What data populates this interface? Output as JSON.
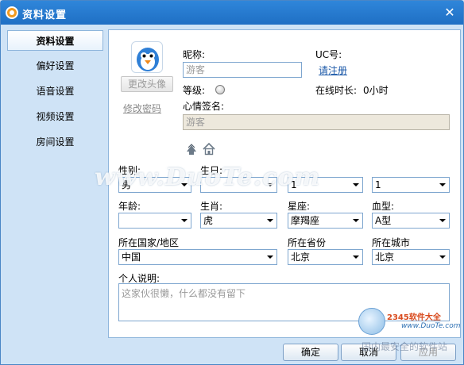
{
  "window": {
    "title": "资料设置",
    "close_glyph": "✕"
  },
  "sidebar": {
    "items": [
      {
        "label": "资料设置",
        "active": true
      },
      {
        "label": "偏好设置"
      },
      {
        "label": "语音设置"
      },
      {
        "label": "视频设置"
      },
      {
        "label": "房间设置"
      }
    ]
  },
  "profile": {
    "change_avatar_label": "更改头像",
    "change_password_label": "修改密码",
    "nickname_label": "昵称:",
    "nickname_value": "游客",
    "uc_label": "UC号:",
    "register_link": "请注册",
    "level_label": "等级:",
    "online_label": "在线时长:",
    "online_value": "0小时",
    "signature_label": "心情签名:",
    "signature_value": "游客",
    "icons": [
      "clover-icon",
      "home-icon"
    ]
  },
  "fields": {
    "gender": {
      "label": "性别:",
      "value": "男"
    },
    "birthday": {
      "label": "生日:",
      "year": "",
      "month": "1",
      "day": "1"
    },
    "age": {
      "label": "年龄:",
      "value": ""
    },
    "zodiac": {
      "label": "生肖:",
      "value": "虎"
    },
    "constellation": {
      "label": "星座:",
      "value": "摩羯座"
    },
    "blood": {
      "label": "血型:",
      "value": "A型"
    },
    "country": {
      "label": "所在国家/地区",
      "value": "中国"
    },
    "province": {
      "label": "所在省份",
      "value": "北京"
    },
    "city": {
      "label": "所在城市",
      "value": "北京"
    },
    "intro": {
      "label": "个人说明:",
      "placeholder": "这家伙很懒，什么都没有留下"
    }
  },
  "buttons": {
    "ok": "确定",
    "cancel": "取消",
    "apply": "应用"
  },
  "watermarks": {
    "site": "www.DuoTe.com",
    "brand": "2345软件大全",
    "brand_url": "www.DuoTe.com",
    "brand_sub": "国内最安全的软件站"
  },
  "colors": {
    "titlebar": "#2f86da",
    "background": "#cfe3f6",
    "border": "#7ea6cf",
    "link": "#1b58a8"
  }
}
